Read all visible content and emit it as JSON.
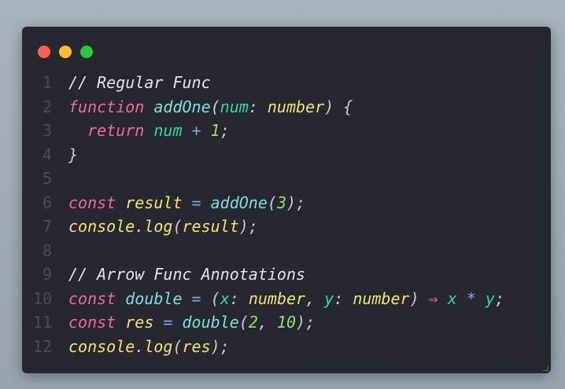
{
  "window_controls": {
    "close_color": "#ff5f57",
    "minimize_color": "#febc2e",
    "maximize_color": "#28c840"
  },
  "colors": {
    "comment": "#e4e2ee",
    "keyword": "#f2689c",
    "function": "#7fdede",
    "param": "#33d6a0",
    "type": "#f0e478",
    "number": "#8ee06a",
    "punct": "#c8c8e0",
    "operator": "#7aa8f0",
    "arrow": "#f2689c",
    "plain": "#e4e2ee"
  },
  "code_lines": [
    {
      "number": "1",
      "tokens": [
        [
          "// Regular Func",
          "comment"
        ]
      ]
    },
    {
      "number": "2",
      "tokens": [
        [
          "function",
          "keyword"
        ],
        [
          " ",
          "plain"
        ],
        [
          "addOne",
          "function"
        ],
        [
          "(",
          "punct"
        ],
        [
          "num",
          "param"
        ],
        [
          ": ",
          "punct"
        ],
        [
          "number",
          "type"
        ],
        [
          ") {",
          "punct"
        ]
      ]
    },
    {
      "number": "3",
      "tokens": [
        [
          "  ",
          "plain"
        ],
        [
          "return",
          "keyword"
        ],
        [
          " ",
          "plain"
        ],
        [
          "num",
          "param"
        ],
        [
          " + ",
          "operator"
        ],
        [
          "1",
          "number"
        ],
        [
          ";",
          "punct"
        ]
      ]
    },
    {
      "number": "4",
      "tokens": [
        [
          "}",
          "punct"
        ]
      ]
    },
    {
      "number": "5",
      "tokens": []
    },
    {
      "number": "6",
      "tokens": [
        [
          "const",
          "keyword"
        ],
        [
          " ",
          "plain"
        ],
        [
          "result",
          "type"
        ],
        [
          " = ",
          "operator"
        ],
        [
          "addOne",
          "function"
        ],
        [
          "(",
          "punct"
        ],
        [
          "3",
          "number"
        ],
        [
          ");",
          "punct"
        ]
      ]
    },
    {
      "number": "7",
      "tokens": [
        [
          "console",
          "type"
        ],
        [
          ".",
          "punct"
        ],
        [
          "log",
          "type"
        ],
        [
          "(",
          "punct"
        ],
        [
          "result",
          "type"
        ],
        [
          ");",
          "punct"
        ]
      ]
    },
    {
      "number": "8",
      "tokens": []
    },
    {
      "number": "9",
      "tokens": [
        [
          "// Arrow Func Annotations",
          "comment"
        ]
      ]
    },
    {
      "number": "10",
      "tokens": [
        [
          "const",
          "keyword"
        ],
        [
          " ",
          "plain"
        ],
        [
          "double",
          "function"
        ],
        [
          " = ",
          "operator"
        ],
        [
          "(",
          "punct"
        ],
        [
          "x",
          "param"
        ],
        [
          ": ",
          "punct"
        ],
        [
          "number",
          "type"
        ],
        [
          ", ",
          "punct"
        ],
        [
          "y",
          "param"
        ],
        [
          ": ",
          "punct"
        ],
        [
          "number",
          "type"
        ],
        [
          ") ",
          "punct"
        ],
        [
          "⇒",
          "arrow"
        ],
        [
          " ",
          "plain"
        ],
        [
          "x",
          "param"
        ],
        [
          " * ",
          "operator"
        ],
        [
          "y",
          "param"
        ],
        [
          ";",
          "punct"
        ]
      ]
    },
    {
      "number": "11",
      "tokens": [
        [
          "const",
          "keyword"
        ],
        [
          " ",
          "plain"
        ],
        [
          "res",
          "type"
        ],
        [
          " = ",
          "operator"
        ],
        [
          "double",
          "function"
        ],
        [
          "(",
          "punct"
        ],
        [
          "2",
          "number"
        ],
        [
          ", ",
          "punct"
        ],
        [
          "10",
          "number"
        ],
        [
          ");",
          "punct"
        ]
      ]
    },
    {
      "number": "12",
      "tokens": [
        [
          "console",
          "type"
        ],
        [
          ".",
          "punct"
        ],
        [
          "log",
          "type"
        ],
        [
          "(",
          "punct"
        ],
        [
          "res",
          "type"
        ],
        [
          ");",
          "punct"
        ]
      ]
    }
  ]
}
